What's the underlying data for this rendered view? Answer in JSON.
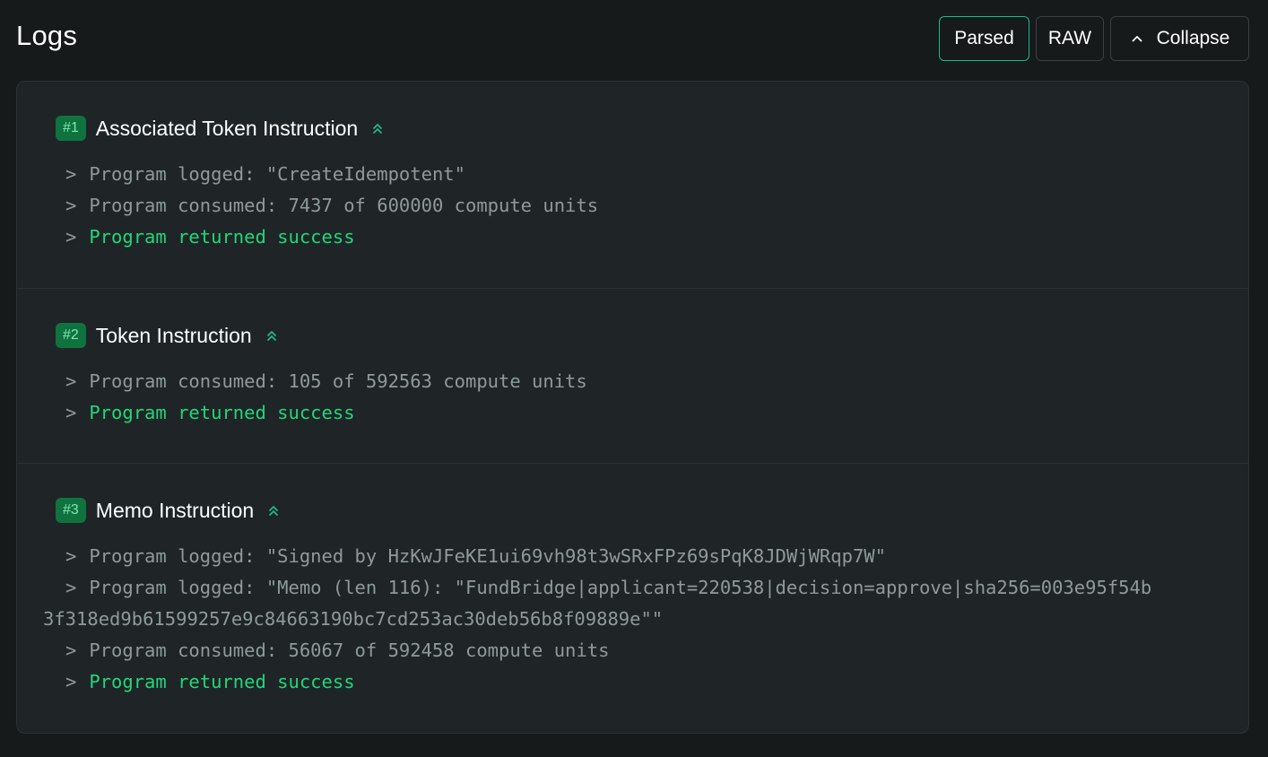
{
  "header": {
    "title": "Logs",
    "buttons": {
      "parsed": "Parsed",
      "raw": "RAW",
      "collapse": "Collapse"
    }
  },
  "colors": {
    "background": "#161a1b",
    "panel": "#1f2526",
    "accent": "#1fb889",
    "badge_bg": "#10733f",
    "badge_text": "#7ee8b0",
    "success": "#22d67a",
    "muted_text": "#8e9a9a"
  },
  "sections": [
    {
      "badge": "#1",
      "title": "Associated Token Instruction",
      "icon": "double-chevron-up-icon",
      "lines": [
        {
          "prefix": ">",
          "text": "Program logged: \"CreateIdempotent\""
        },
        {
          "prefix": ">",
          "text": "Program consumed: 7437 of 600000 compute units"
        },
        {
          "prefix": ">",
          "text": "Program returned success",
          "status": "success"
        }
      ]
    },
    {
      "badge": "#2",
      "title": "Token Instruction",
      "icon": "double-chevron-up-icon",
      "lines": [
        {
          "prefix": ">",
          "text": "Program consumed: 105 of 592563 compute units"
        },
        {
          "prefix": ">",
          "text": "Program returned success",
          "status": "success"
        }
      ]
    },
    {
      "badge": "#3",
      "title": "Memo Instruction",
      "icon": "double-chevron-up-icon",
      "lines": [
        {
          "prefix": ">",
          "text": "Program logged: \"Signed by HzKwJFeKE1ui69vh98t3wSRxFPz69sPqK8JDWjWRqp7W\""
        },
        {
          "prefix": ">",
          "text": "Program logged: \"Memo (len 116): \"FundBridge|applicant=220538|decision=approve|sha256=003e95f54b",
          "continuation": "3f318ed9b61599257e9c84663190bc7cd253ac30deb56b8f09889e\"\""
        },
        {
          "prefix": ">",
          "text": "Program consumed: 56067 of 592458 compute units"
        },
        {
          "prefix": ">",
          "text": "Program returned success",
          "status": "success"
        }
      ]
    }
  ]
}
